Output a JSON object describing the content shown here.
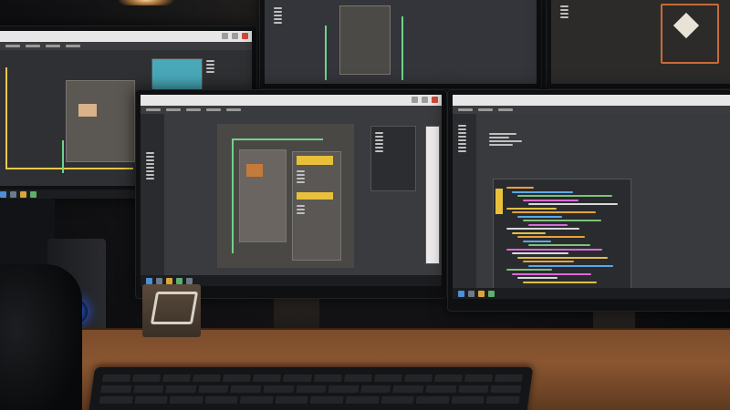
{
  "scene": {
    "description_colors": {
      "desk": "#8a5631",
      "schematic_wire": "#6fd38a",
      "note_yellow": "#e8c03a",
      "speaker_led": "#3d7cff"
    },
    "monitors": [
      {
        "id": "top-left",
        "content": "schematic-editor"
      },
      {
        "id": "top-center",
        "content": "schematic-editor"
      },
      {
        "id": "top-right",
        "content": "graph-view"
      },
      {
        "id": "bottom-center",
        "content": "schematic-editor-with-notes"
      },
      {
        "id": "bottom-right",
        "content": "code-editor"
      }
    ],
    "icons": [
      "close-icon",
      "logo-icon",
      "speaker-led-icon"
    ]
  }
}
